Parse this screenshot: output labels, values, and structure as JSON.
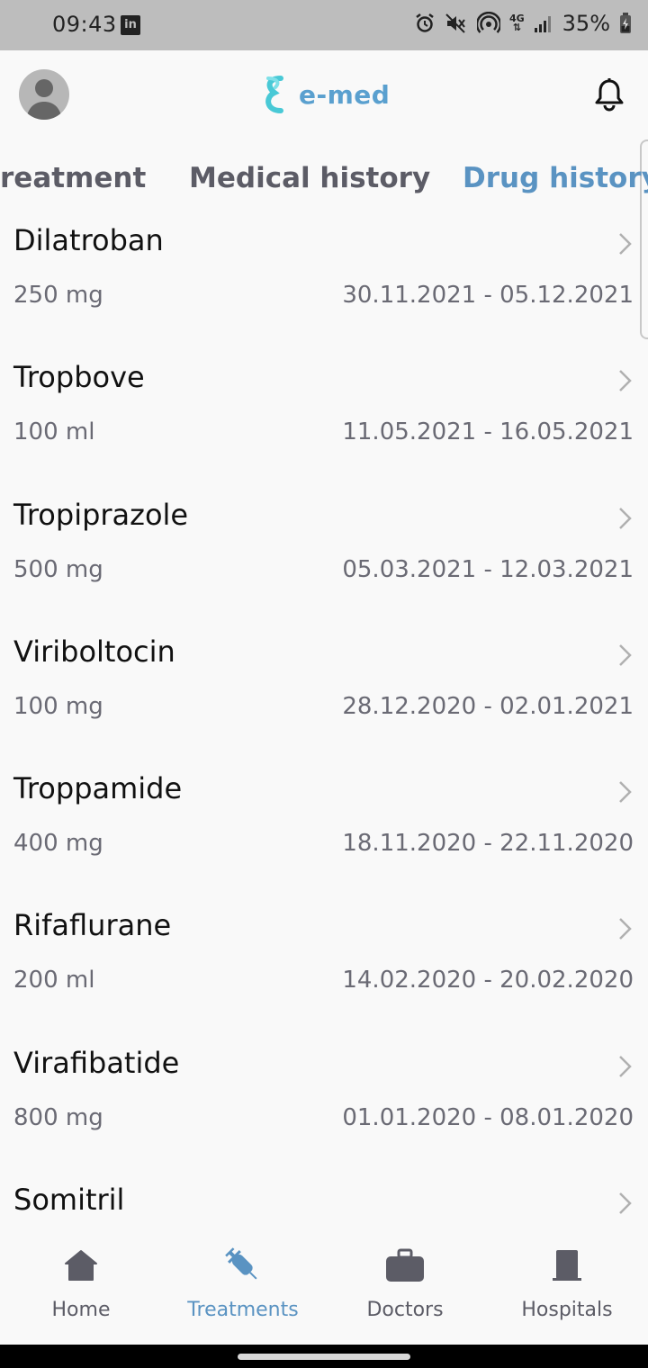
{
  "status": {
    "time": "09:43",
    "linkedin_badge": "in",
    "network": "4G",
    "battery": "35%"
  },
  "header": {
    "logo_text": "e-med",
    "brand_color": "#5aa0cf"
  },
  "tabs": [
    {
      "label": "reatment",
      "active": false
    },
    {
      "label": "Medical history",
      "active": false
    },
    {
      "label": "Drug history",
      "active": true
    }
  ],
  "drugs": [
    {
      "name": "Dilatroban",
      "dose": "250 mg",
      "dates": "30.11.2021 - 05.12.2021"
    },
    {
      "name": "Tropbove",
      "dose": "100 ml",
      "dates": "11.05.2021 - 16.05.2021"
    },
    {
      "name": "Tropiprazole",
      "dose": "500 mg",
      "dates": "05.03.2021 - 12.03.2021"
    },
    {
      "name": "Viriboltocin",
      "dose": "100 mg",
      "dates": "28.12.2020 - 02.01.2021"
    },
    {
      "name": "Troppamide",
      "dose": "400 mg",
      "dates": "18.11.2020 - 22.11.2020"
    },
    {
      "name": "Rifaflurane",
      "dose": "200 ml",
      "dates": "14.02.2020 - 20.02.2020"
    },
    {
      "name": "Virafibatide",
      "dose": "800 mg",
      "dates": "01.01.2020 - 08.01.2020"
    },
    {
      "name": "Somitril",
      "dose": "",
      "dates": ""
    }
  ],
  "bottom_nav": [
    {
      "label": "Home",
      "icon": "home-icon",
      "active": false
    },
    {
      "label": "Treatments",
      "icon": "syringe-icon",
      "active": true
    },
    {
      "label": "Doctors",
      "icon": "briefcase-icon",
      "active": false
    },
    {
      "label": "Hospitals",
      "icon": "door-icon",
      "active": false
    }
  ],
  "colors": {
    "active": "#5a93c2",
    "inactive": "#5c5c66"
  }
}
